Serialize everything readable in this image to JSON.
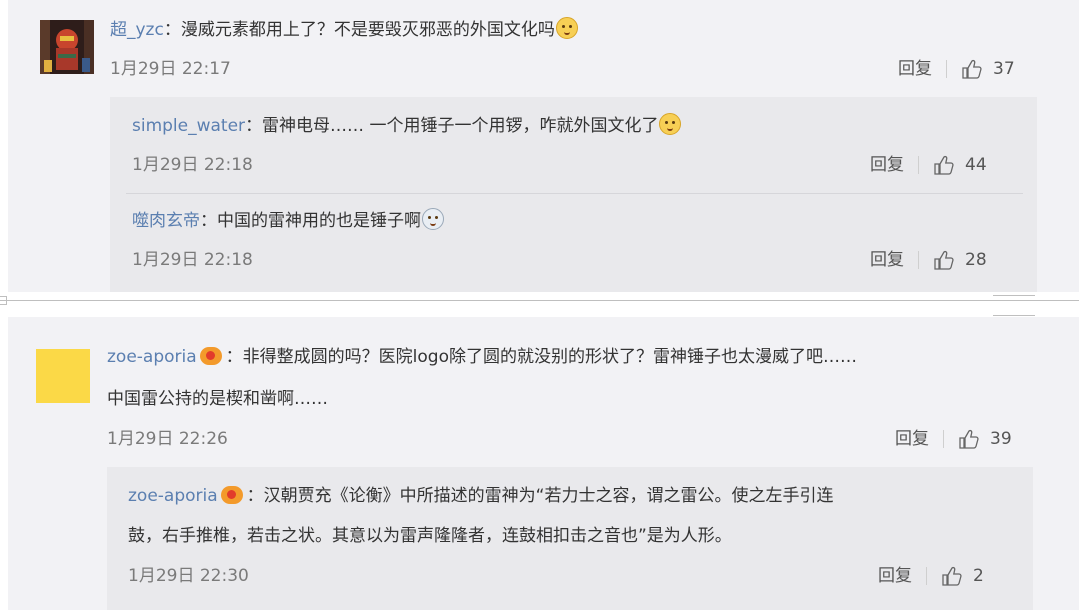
{
  "comments": [
    {
      "user": "超_yzc",
      "text": "：漫威元素都用上了？不是要毁灭邪恶的外国文化吗",
      "date": "1月29日 22:17",
      "reply_label": "回复",
      "likes": "37",
      "replies": [
        {
          "user": "simple_water",
          "text": "：雷神电母…… 一个用锤子一个用锣，咋就外国文化了",
          "date": "1月29日 22:18",
          "reply_label": "回复",
          "likes": "44"
        },
        {
          "user": "噬肉玄帝",
          "text": "：中国的雷神用的也是锤子啊",
          "date": "1月29日 22:18",
          "reply_label": "回复",
          "likes": "28"
        }
      ]
    },
    {
      "user": "zoe-aporia",
      "text_line1": "：非得整成圆的吗？医院logo除了圆的就没别的形状了？雷神锤子也太漫威了吧……",
      "text_line2": "中国雷公持的是楔和凿啊……",
      "date": "1月29日 22:26",
      "reply_label": "回复",
      "likes": "39",
      "replies": [
        {
          "user": "zoe-aporia",
          "text_line1": "：汉朝贾充《论衡》中所描述的雷神为“若力士之容，谓之雷公。使之左手引连",
          "text_line2": "鼓，右手推椎，若击之状。其意以为雷声隆隆者，连鼓相扣击之音也”是为人形。",
          "date": "1月29日 22:30",
          "reply_label": "回复",
          "likes": "2"
        }
      ]
    }
  ],
  "icons": {
    "like": "thumbs-up-icon",
    "emoji": "doge-emoji-icon",
    "badge": "vip-badge-icon"
  },
  "colors": {
    "username": "#5b7fb0",
    "panel": "#f2f2f5",
    "subpanel": "#e9e9ec",
    "avatar2": "#fbd947"
  }
}
